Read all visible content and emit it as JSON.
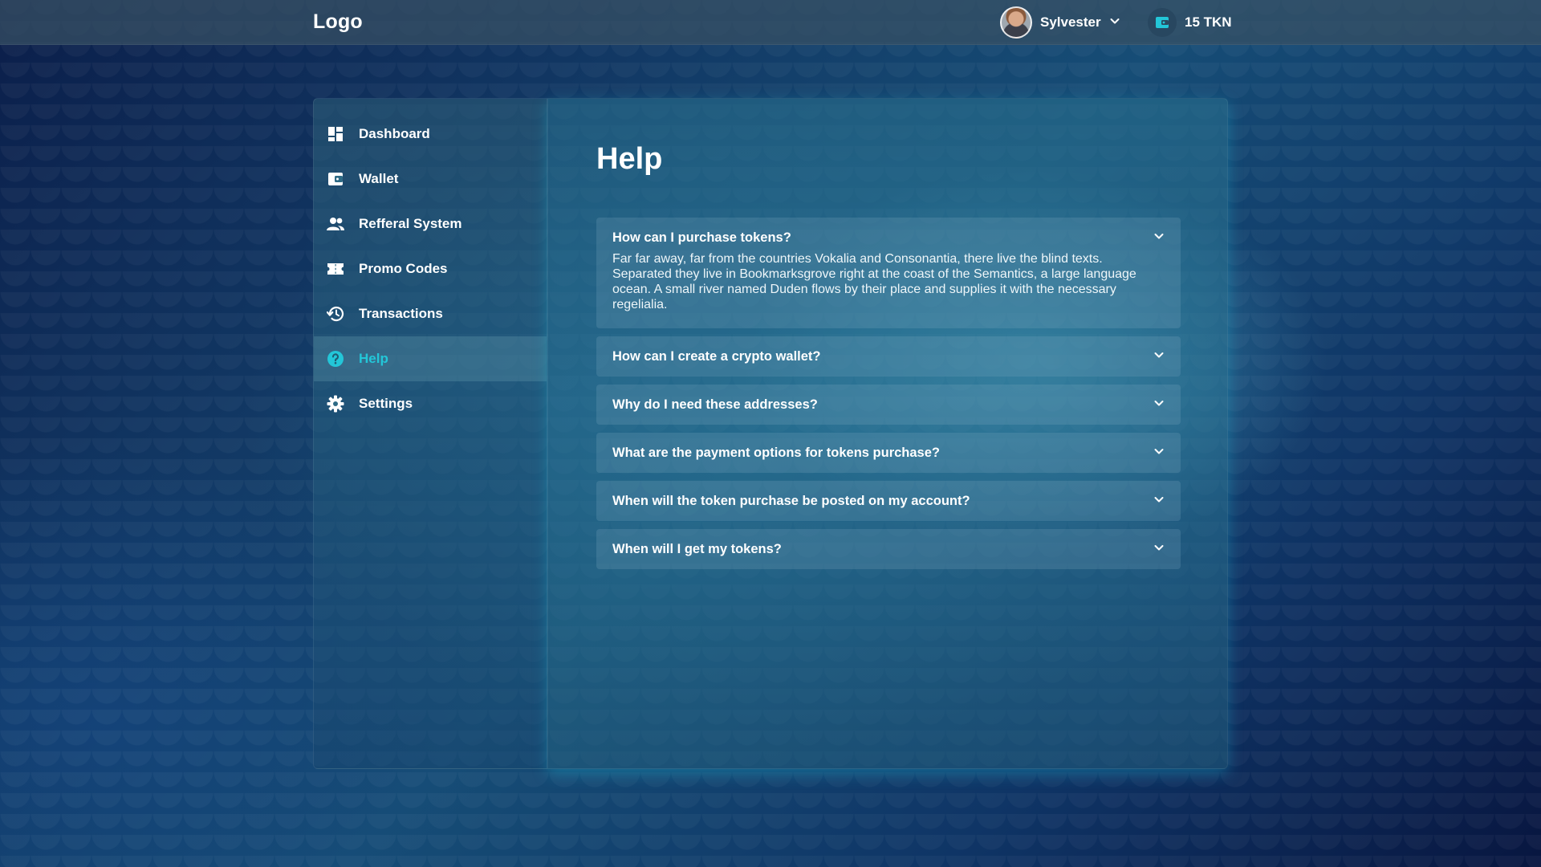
{
  "header": {
    "logo": "Logo",
    "user_name": "Sylvester",
    "balance": "15 TKN"
  },
  "sidebar": {
    "items": [
      {
        "label": "Dashboard",
        "icon": "dashboard-icon",
        "active": false
      },
      {
        "label": "Wallet",
        "icon": "wallet-icon",
        "active": false
      },
      {
        "label": "Refferal System",
        "icon": "people-icon",
        "active": false
      },
      {
        "label": "Promo Codes",
        "icon": "ticket-icon",
        "active": false
      },
      {
        "label": "Transactions",
        "icon": "history-icon",
        "active": false
      },
      {
        "label": "Help",
        "icon": "help-icon",
        "active": true
      },
      {
        "label": "Settings",
        "icon": "gear-icon",
        "active": false
      }
    ]
  },
  "main": {
    "title": "Help",
    "faq": [
      {
        "question": "How can I purchase tokens?",
        "expanded": true,
        "answer": "Far far away, far from the countries Vokalia and Consonantia, there live the blind texts. Separated they live in Bookmarksgrove right at the coast of the Semantics, a large language ocean. A small river named Duden flows by their place and supplies it with the necessary regelialia."
      },
      {
        "question": "How can I create a crypto wallet?",
        "expanded": false
      },
      {
        "question": "Why do I need these addresses?",
        "expanded": false
      },
      {
        "question": "What are the payment options for tokens purchase?",
        "expanded": false
      },
      {
        "question": "When will the token purchase be posted on my account?",
        "expanded": false
      },
      {
        "question": "When will I get my tokens?",
        "expanded": false
      }
    ]
  },
  "colors": {
    "accent": "#23c6d8",
    "text": "#ffffff"
  }
}
